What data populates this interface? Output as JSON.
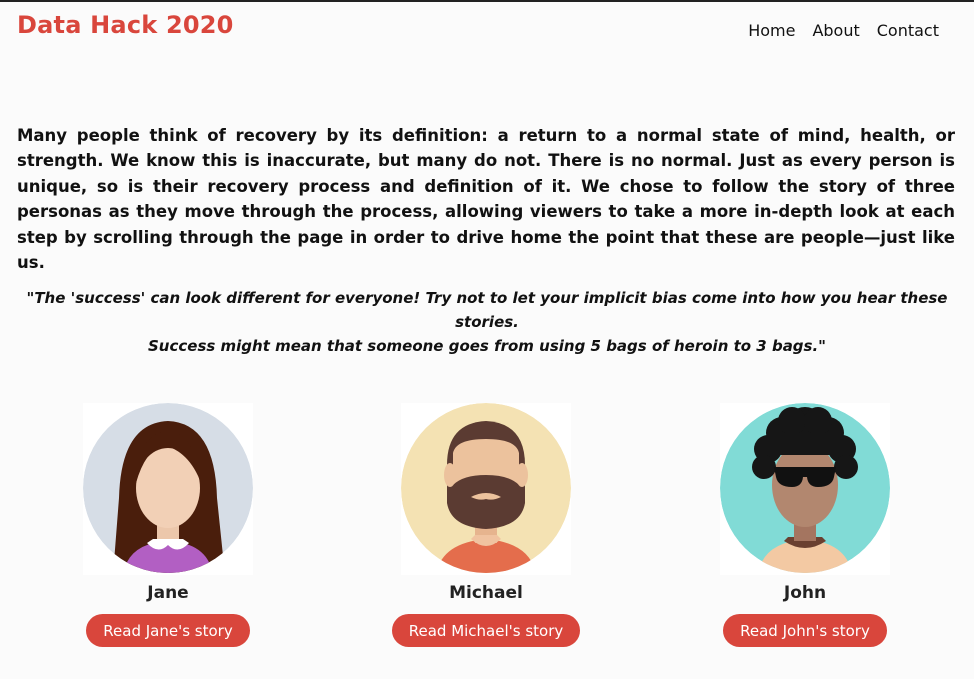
{
  "header": {
    "brand": "Data Hack 2020",
    "nav": [
      "Home",
      "About",
      "Contact"
    ]
  },
  "intro": "Many people think of recovery by its definition: a return to a normal state of mind, health, or strength. We know this is inaccurate, but many do not. There is no normal. Just as every person is unique, so is their recovery process and definition of it. We chose to follow the story of three personas as they move through the process, allowing viewers to take a more in-depth look at each step by scrolling through the page in order to drive home the point that these are people—just like us.",
  "quote": {
    "line1": "\"The 'success' can look different for everyone! Try not to let your implicit bias come into how you hear these stories.",
    "line2": "Success might mean that someone goes from using 5 bags of heroin to 3 bags.\""
  },
  "personas": [
    {
      "name": "Jane",
      "button": "Read Jane's story",
      "avatar_icon": "woman-avatar-icon"
    },
    {
      "name": "Michael",
      "button": "Read Michael's story",
      "avatar_icon": "bearded-man-avatar-icon"
    },
    {
      "name": "John",
      "button": "Read John's story",
      "avatar_icon": "curly-hair-sunglasses-avatar-icon"
    }
  ],
  "colors": {
    "accent": "#d9463c",
    "text": "#111111",
    "background": "#fbfbfb"
  }
}
